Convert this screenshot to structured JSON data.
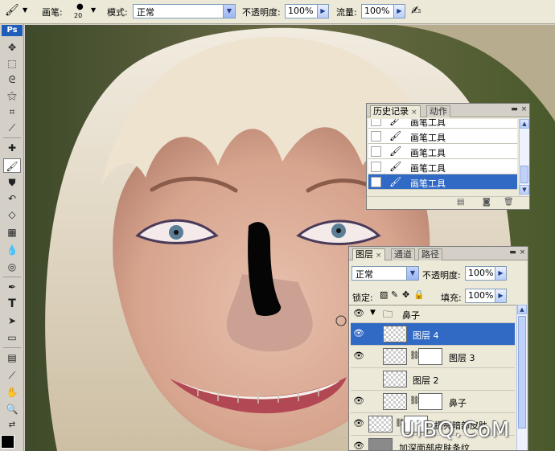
{
  "options_bar": {
    "brush_label": "画笔:",
    "brush_size": "20",
    "mode_label": "模式:",
    "mode_value": "正常",
    "opacity_label": "不透明度:",
    "opacity_value": "100%",
    "flow_label": "流量:",
    "flow_value": "100%"
  },
  "toolbar": {
    "logo": "Ps",
    "tools": [
      "move-tool",
      "marquee-tool",
      "lasso-tool",
      "magic-wand-tool",
      "crop-tool",
      "slice-tool",
      "healing-brush-tool",
      "brush-tool",
      "clone-stamp-tool",
      "history-brush-tool",
      "eraser-tool",
      "gradient-tool",
      "blur-tool",
      "dodge-tool",
      "pen-tool",
      "type-tool",
      "path-select-tool",
      "shape-tool",
      "notes-tool",
      "eyedropper-tool",
      "hand-tool",
      "zoom-tool"
    ],
    "active_tool": "brush-tool"
  },
  "history_panel": {
    "tabs": [
      "历史记录",
      "动作"
    ],
    "active_tab": "历史记录",
    "items": [
      "画笔工具",
      "画笔工具",
      "画笔工具",
      "画笔工具",
      "画笔工具"
    ],
    "selected_index": 4
  },
  "layers_panel": {
    "tabs": [
      "图层",
      "通道",
      "路径"
    ],
    "active_tab": "图层",
    "blend_mode": "正常",
    "opacity_label": "不透明度:",
    "opacity_value": "100%",
    "lock_label": "锁定:",
    "fill_label": "填充:",
    "fill_value": "100%",
    "group_name": "鼻子",
    "layers": [
      {
        "name": "图层 4",
        "selected": true,
        "has_mask": false
      },
      {
        "name": "图层 3",
        "selected": false,
        "has_mask": true
      },
      {
        "name": "图层 2",
        "selected": false,
        "has_mask": false
      },
      {
        "name": "鼻子",
        "selected": false,
        "has_mask": true
      },
      {
        "name": "提亮暗部皮肤",
        "selected": false,
        "has_mask": true
      },
      {
        "name": "加深面部皮肤条纹",
        "selected": false,
        "has_mask": false
      }
    ]
  },
  "watermark": "UiBQ.CoM",
  "colors": {
    "selection": "#316ac5",
    "panel_bg": "#ece9d8",
    "foreground": "#000000"
  }
}
